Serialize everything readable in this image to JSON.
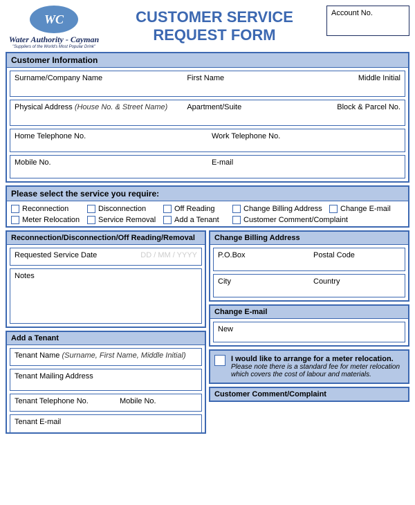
{
  "header": {
    "org_name": "Water Authority - Cayman",
    "tagline": "\"Suppliers of the World's Most Popular Drink\"",
    "logo_text": "WC",
    "title_line1": "CUSTOMER SERVICE",
    "title_line2": "REQUEST FORM",
    "account_no_label": "Account No."
  },
  "customer": {
    "heading": "Customer Information",
    "surname": "Surname/Company Name",
    "first_name": "First Name",
    "middle_initial": "Middle Initial",
    "address": "Physical Address",
    "address_hint": "(House No. & Street Name)",
    "apt": "Apartment/Suite",
    "block": "Block & Parcel No.",
    "home_tel": "Home Telephone No.",
    "work_tel": "Work Telephone No.",
    "mobile": "Mobile No.",
    "email": "E-mail"
  },
  "services": {
    "heading": "Please select the service you require:",
    "options": {
      "reconnection": "Reconnection",
      "disconnection": "Disconnection",
      "off_reading": "Off Reading",
      "change_billing": "Change Billing Address",
      "change_email": "Change E-mail",
      "meter_relocation": "Meter Relocation",
      "service_removal": "Service Removal",
      "add_tenant": "Add a Tenant",
      "customer_comment": "Customer Comment/Complaint"
    }
  },
  "left": {
    "rdor_heading": "Reconnection/Disconnection/Off Reading/Removal",
    "req_date": "Requested Service Date",
    "date_placeholder": "DD / MM / YYYY",
    "notes": "Notes",
    "add_tenant_heading": "Add a Tenant",
    "tenant_name": "Tenant Name",
    "tenant_name_hint": "(Surname, First Name, Middle Initial)",
    "tenant_mail": "Tenant Mailing Address",
    "tenant_tel": "Tenant Telephone No.",
    "tenant_mobile": "Mobile No.",
    "tenant_email": "Tenant E-mail"
  },
  "right": {
    "cba_heading": "Change Billing Address",
    "pobox": "P.O.Box",
    "postal": "Postal Code",
    "city": "City",
    "country": "Country",
    "ce_heading": "Change E-mail",
    "new": "New",
    "meter_bold": "I would like to arrange for a meter relocation.",
    "meter_note": "Please note there is a standard fee for meter relocation which covers the cost of labour and materials.",
    "cc_heading": "Customer Comment/Complaint"
  }
}
